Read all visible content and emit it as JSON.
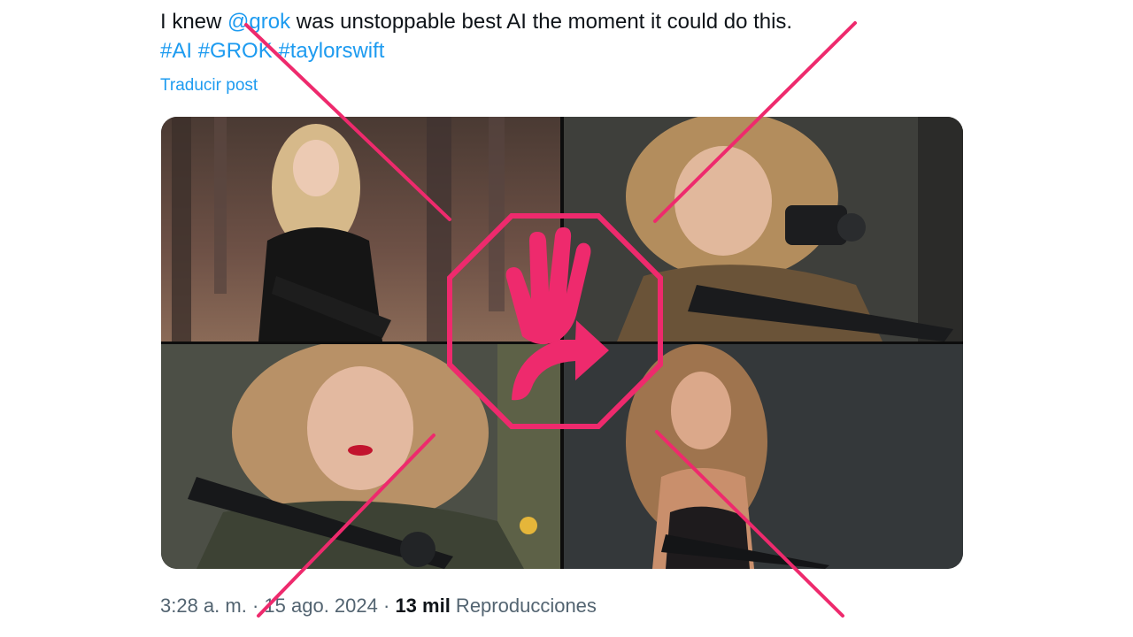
{
  "tweet": {
    "text_before": "I knew ",
    "mention": "@grok",
    "text_after": " was unstoppable best AI the moment it could do this.",
    "hashtags": [
      "#AI",
      "#GROK",
      "#taylorswift"
    ],
    "translate_label": "Traducir post",
    "time": "3:28 a. m.",
    "sep": " · ",
    "date": "15 ago. 2024",
    "sep2": " · ",
    "views_count": "13 mil",
    "views_label": " Reproducciones"
  },
  "media": {
    "images": [
      {
        "description": "generated image 1"
      },
      {
        "description": "generated image 2"
      },
      {
        "description": "generated image 3"
      },
      {
        "description": "generated image 4"
      }
    ]
  },
  "overlay": {
    "stamp_color": "#ee2a6d",
    "stamp_icon": "stop-hand-icon"
  }
}
